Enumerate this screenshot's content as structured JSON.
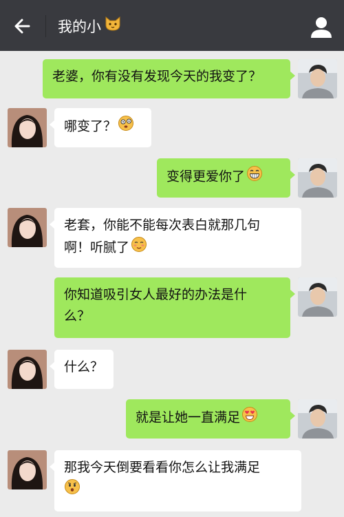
{
  "header": {
    "title": "我的小",
    "back_icon": "back-arrow-icon",
    "title_icon": "cat-face-icon",
    "profile_icon": "person-icon"
  },
  "colors": {
    "header_bg": "#393a3f",
    "chat_bg": "#ebebeb",
    "outgoing_bubble": "#9fe85d",
    "incoming_bubble": "#ffffff"
  },
  "messages": [
    {
      "sender": "me",
      "text": "老婆，你有没有发现今天的我变了？",
      "emoji": ""
    },
    {
      "sender": "her",
      "text": "哪变了？",
      "emoji": "dizzy-face-icon"
    },
    {
      "sender": "me",
      "text": "变得更爱你了",
      "emoji": "grin-face-icon"
    },
    {
      "sender": "her",
      "text": "老套，你能不能每次表白就那几句",
      "text2": "啊！听腻了",
      "emoji": "blushing-face-icon"
    },
    {
      "sender": "me",
      "text": "你知道吸引女人最好的办法是什",
      "text2": "么？",
      "emoji": ""
    },
    {
      "sender": "her",
      "text": "什么？",
      "emoji": ""
    },
    {
      "sender": "me",
      "text": "就是让她一直满足",
      "emoji": "heart-eyes-face-icon"
    },
    {
      "sender": "her",
      "text": "那我今天倒要看看你怎么让我满足",
      "emoji": "surprised-face-icon"
    }
  ]
}
